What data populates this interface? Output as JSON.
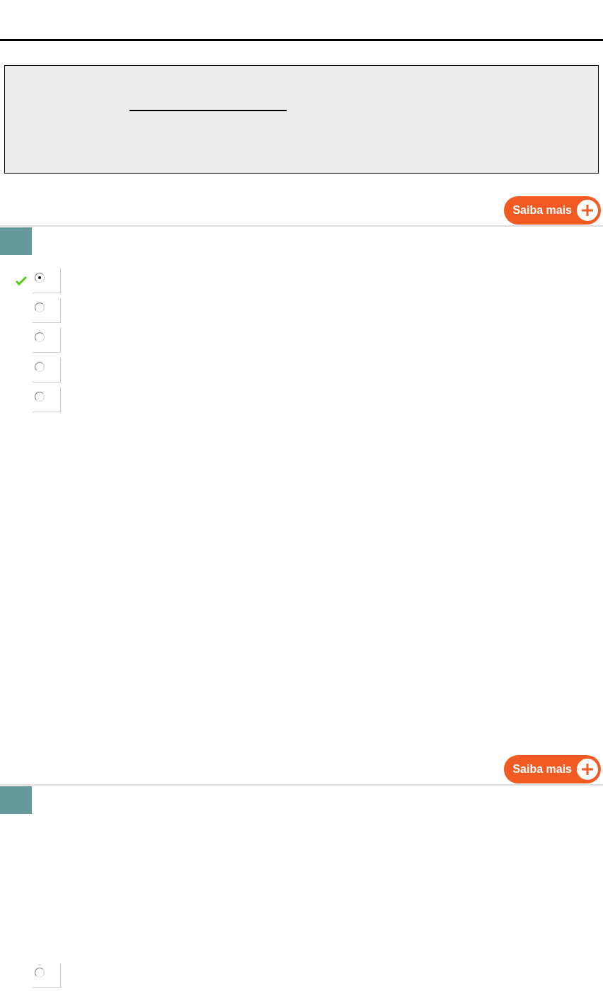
{
  "questions": [
    {
      "more_button": "Saiba mais",
      "options": [
        {
          "selected": true,
          "correct": true
        },
        {
          "selected": false,
          "correct": false
        },
        {
          "selected": false,
          "correct": false
        },
        {
          "selected": false,
          "correct": false
        },
        {
          "selected": false,
          "correct": false
        }
      ]
    },
    {
      "more_button": "Saiba mais",
      "options": [
        {
          "selected": false,
          "correct": false
        }
      ]
    }
  ]
}
